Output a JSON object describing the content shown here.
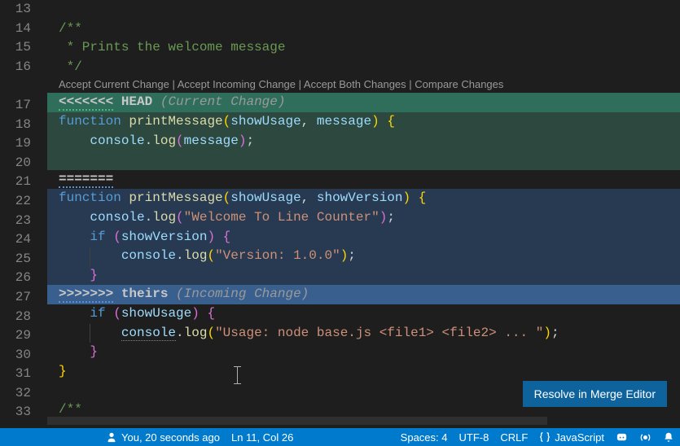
{
  "gutter": {
    "start": 13,
    "end": 33
  },
  "doc": {
    "c1": "/**",
    "c2": " * Prints the welcome message",
    "c3": " */",
    "head_marker": "<<<<<<<",
    "head_label": "HEAD",
    "head_note": "(Current Change)",
    "fn_kw": "function",
    "fn_name": "printMessage",
    "param_showUsage": "showUsage",
    "param_message": "message",
    "param_showVersion": "showVersion",
    "console": "console",
    "log": "log",
    "str_welcome": "\"Welcome To Line Counter\"",
    "str_version": "\"Version: 1.0.0\"",
    "str_usage": "\"Usage: node base.js <file1> <file2> ... \"",
    "if_kw": "if",
    "sep_marker": "=======",
    "theirs_marker": ">>>>>>>",
    "theirs_label": "theirs",
    "theirs_note": "(Incoming Change)",
    "c4": "/**"
  },
  "codelens": {
    "acceptCurrent": "Accept Current Change",
    "acceptIncoming": "Accept Incoming Change",
    "acceptBoth": "Accept Both Changes",
    "compare": "Compare Changes",
    "sep": " | "
  },
  "resolveBtn": "Resolve in Merge Editor",
  "statusbar": {
    "blame": "You, 20 seconds ago",
    "pos": "Ln 11, Col 26",
    "spaces": "Spaces: 4",
    "encoding": "UTF-8",
    "eol": "CRLF",
    "lang": "JavaScript"
  },
  "colors": {
    "accent": "#007acc"
  }
}
